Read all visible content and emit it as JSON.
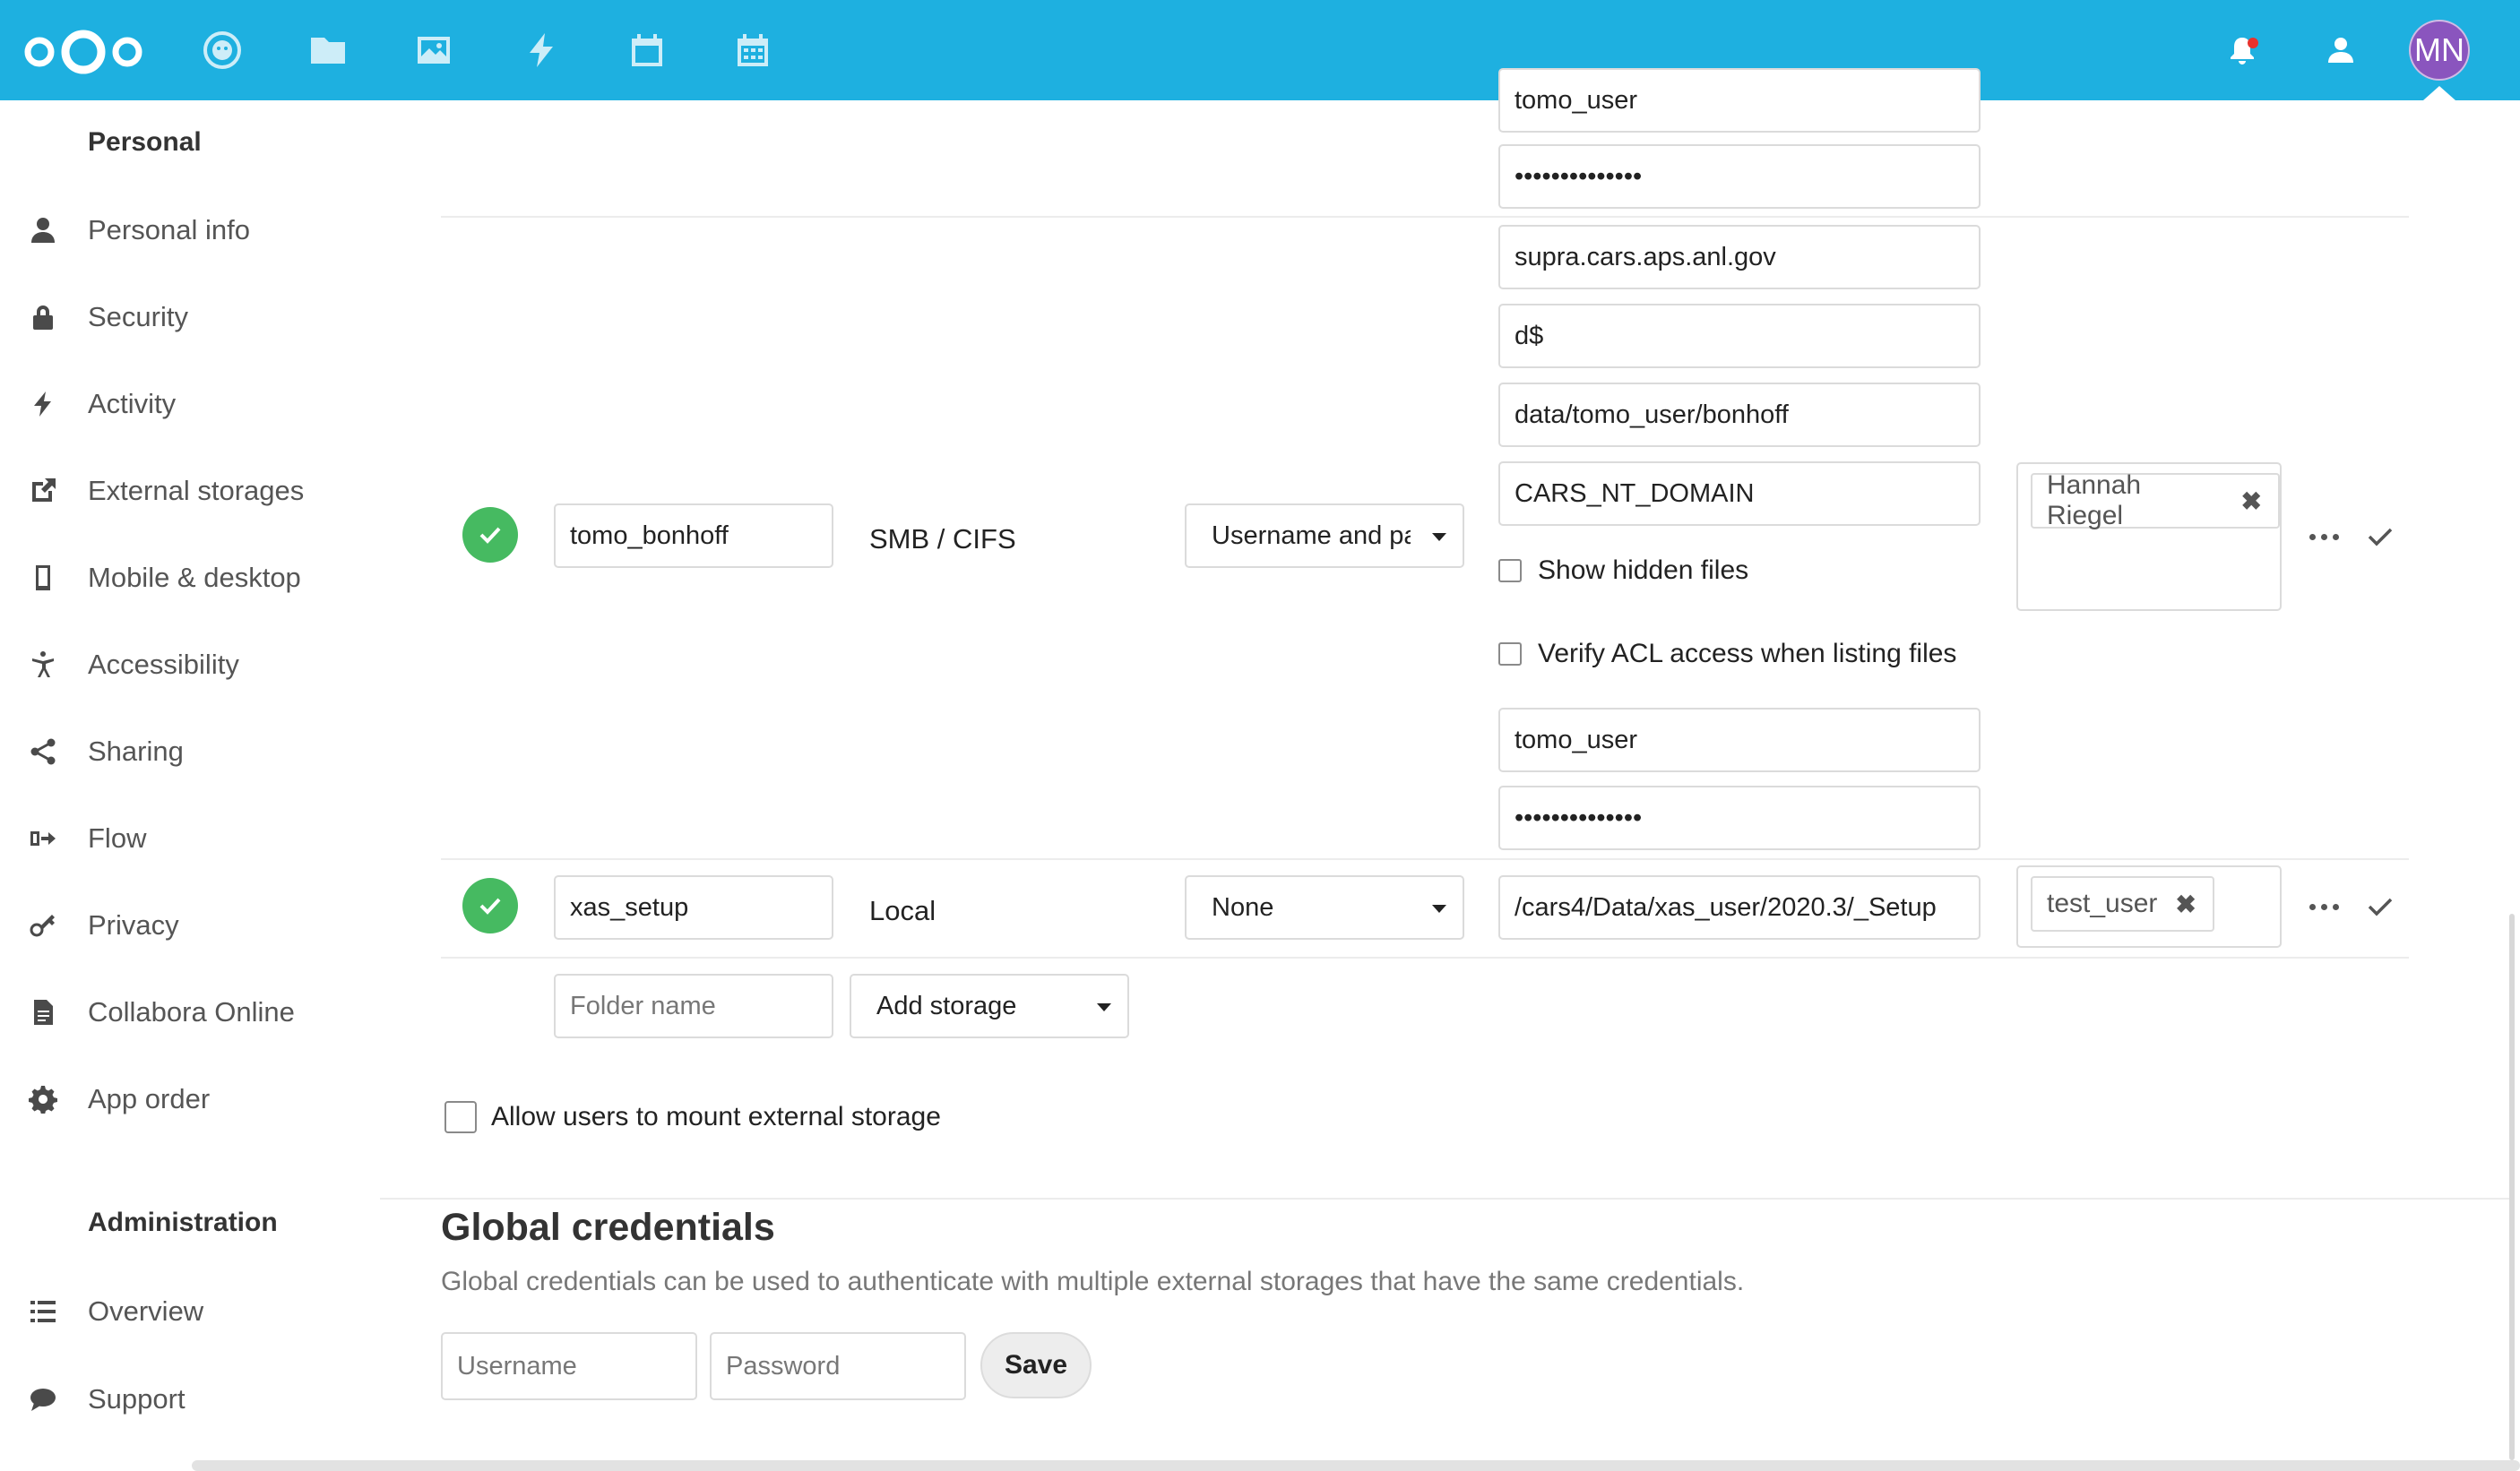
{
  "header": {
    "apps": [
      {
        "icon": "dashboard-icon"
      },
      {
        "icon": "files-icon"
      },
      {
        "icon": "photos-icon"
      },
      {
        "icon": "activity-icon"
      },
      {
        "icon": "calendar-icon"
      },
      {
        "icon": "calendar-grid-icon"
      }
    ],
    "avatar_initials": "MN",
    "colors": {
      "brand": "#1eb0e0",
      "avatar": "#8a55be",
      "status_ok": "#46ba61"
    }
  },
  "sidebar": {
    "personal_heading": "Personal",
    "personal_items": [
      {
        "label": "Personal info",
        "icon": "person-icon"
      },
      {
        "label": "Security",
        "icon": "lock-icon"
      },
      {
        "label": "Activity",
        "icon": "activity-icon"
      },
      {
        "label": "External storages",
        "icon": "external-link-icon"
      },
      {
        "label": "Mobile & desktop",
        "icon": "phone-icon"
      },
      {
        "label": "Accessibility",
        "icon": "accessibility-icon"
      },
      {
        "label": "Sharing",
        "icon": "share-icon"
      },
      {
        "label": "Flow",
        "icon": "flow-icon"
      },
      {
        "label": "Privacy",
        "icon": "key-icon"
      },
      {
        "label": "Collabora Online",
        "icon": "document-icon"
      },
      {
        "label": "App order",
        "icon": "gear-icon"
      }
    ],
    "admin_heading": "Administration",
    "admin_items": [
      {
        "label": "Overview",
        "icon": "list-icon"
      },
      {
        "label": "Support",
        "icon": "speech-bubble-icon"
      }
    ]
  },
  "storages": {
    "prev_row": {
      "username_partial": "tomo_user",
      "password_mask": "••••••••••••••"
    },
    "row1": {
      "folder_name": "tomo_bonhoff",
      "backend": "SMB / CIFS",
      "auth": "Username and pa",
      "host": "supra.cars.aps.anl.gov",
      "share": "d$",
      "remote_subfolder": "data/tomo_user/bonhoff",
      "domain": "CARS_NT_DOMAIN",
      "show_hidden_label": "Show hidden files",
      "verify_acl_label": "Verify ACL access when listing files",
      "username": "tomo_user",
      "password_mask": "••••••••••••••",
      "applicable": "Hannah Riegel"
    },
    "row2": {
      "folder_name": "xas_setup",
      "backend": "Local",
      "auth": "None",
      "location": "/cars4/Data/xas_user/2020.3/_Setup",
      "applicable": "test_user"
    },
    "new_row": {
      "folder_placeholder": "Folder name",
      "add_storage": "Add storage"
    },
    "allow_users_label": "Allow users to mount external storage"
  },
  "global_credentials": {
    "title": "Global credentials",
    "description": "Global credentials can be used to authenticate with multiple external storages that have the same credentials.",
    "username_placeholder": "Username",
    "password_placeholder": "Password",
    "save_label": "Save"
  }
}
